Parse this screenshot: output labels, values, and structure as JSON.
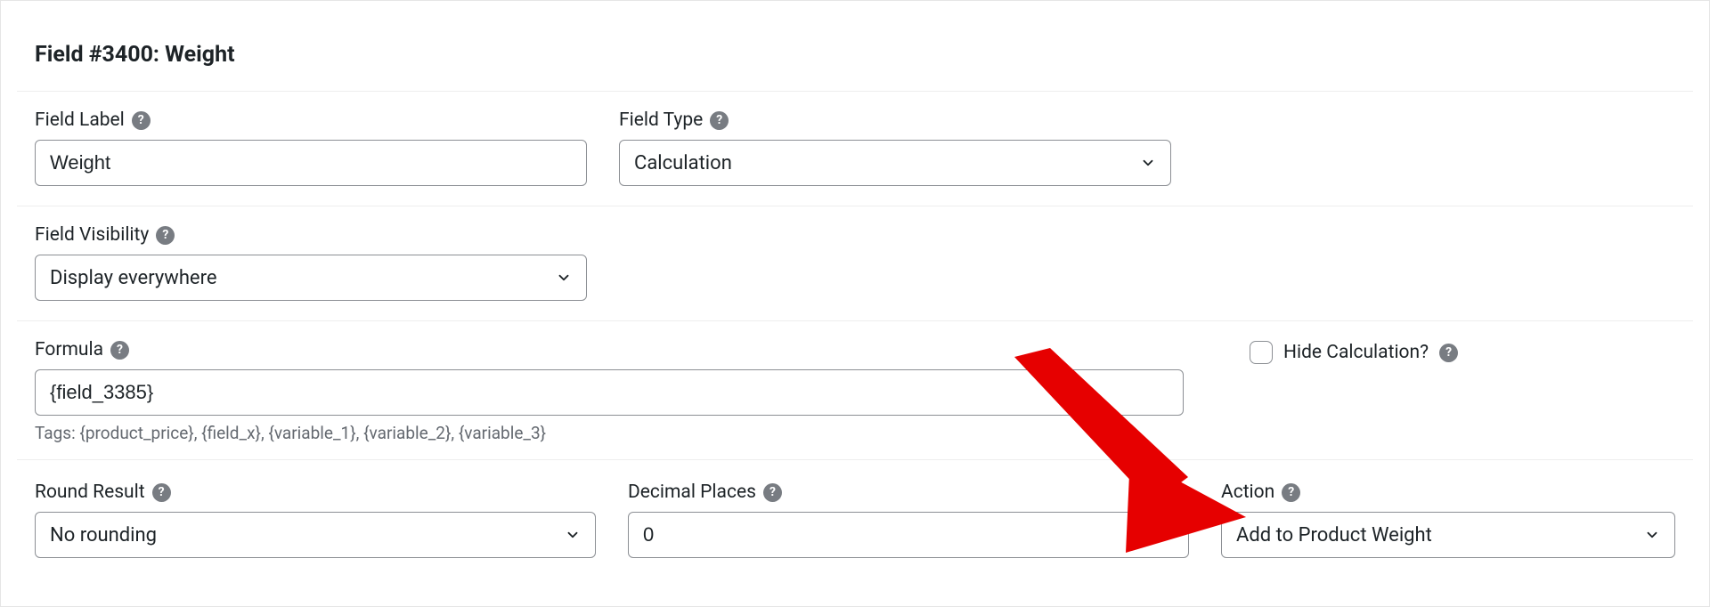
{
  "panel": {
    "title": "Field #3400: Weight"
  },
  "labels": {
    "field_label": "Field Label",
    "field_type": "Field Type",
    "field_visibility": "Field Visibility",
    "formula": "Formula",
    "hide_calculation": "Hide Calculation?",
    "round_result": "Round Result",
    "decimal_places": "Decimal Places",
    "action": "Action"
  },
  "values": {
    "field_label": "Weight",
    "field_type": "Calculation",
    "field_visibility": "Display everywhere",
    "formula": "{field_3385}",
    "round_result": "No rounding",
    "decimal_places": "0",
    "action": "Add to Product Weight"
  },
  "helper": {
    "formula_tags": "Tags: {product_price}, {field_x}, {variable_1}, {variable_2}, {variable_3}"
  }
}
